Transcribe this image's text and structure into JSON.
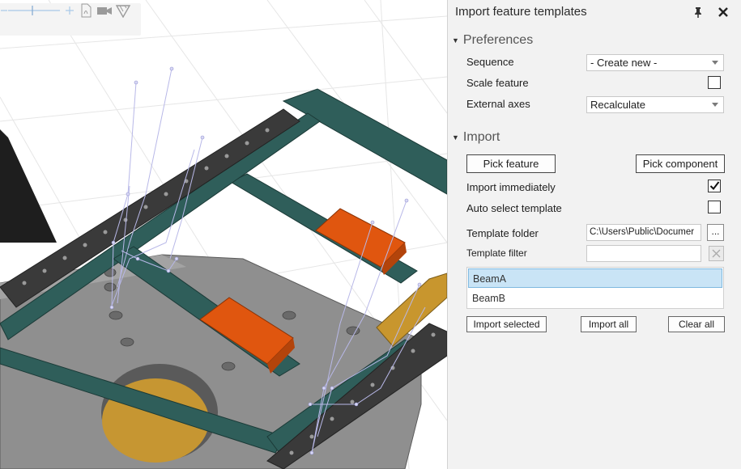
{
  "panel": {
    "title": "Import feature templates",
    "header_icons": [
      "pin-icon",
      "close-icon"
    ]
  },
  "preferences": {
    "header": "Preferences",
    "sequence_label": "Sequence",
    "sequence_value": "- Create new -",
    "scale_feature_label": "Scale feature",
    "scale_feature_checked": false,
    "external_axes_label": "External axes",
    "external_axes_value": "Recalculate"
  },
  "import": {
    "header": "Import",
    "pick_feature_label": "Pick feature",
    "pick_component_label": "Pick component",
    "import_immediately_label": "Import immediately",
    "import_immediately_checked": true,
    "auto_select_label": "Auto select template",
    "auto_select_checked": false,
    "template_folder_label": "Template folder",
    "template_folder_value": "C:\\Users\\Public\\Documer",
    "browse_label": "...",
    "template_filter_label": "Template filter",
    "template_filter_value": "",
    "templates": [
      {
        "name": "BeamA",
        "selected": true
      },
      {
        "name": "BeamB",
        "selected": false
      }
    ],
    "import_selected_label": "Import selected",
    "import_all_label": "Import all",
    "clear_all_label": "Clear all"
  },
  "viewport_toolbar": {
    "icons": [
      "zoom-out-icon",
      "zoom-slider",
      "zoom-in-icon",
      "pdf-export-icon",
      "video-record-icon",
      "measure-icon"
    ]
  },
  "colors": {
    "frame": "#2f5e5a",
    "perforated_rail": "#3a3a3a",
    "orange_block": "#e0560f",
    "gold_block": "#c8962e",
    "base_plate": "#8f8f8f",
    "hole_fill": "#c69632",
    "selection": "#c9e4f6",
    "panel_bg": "#f2f2f2"
  }
}
